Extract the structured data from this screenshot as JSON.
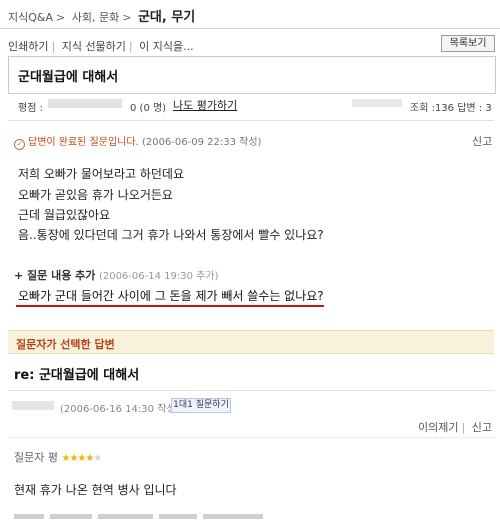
{
  "breadcrumb": {
    "root": "지식Q&A",
    "section": "사회, 문화",
    "current": "군대, 무기"
  },
  "toolbar": {
    "print": "인쇄하기",
    "gift": "지식 선물하기",
    "thisknow": "이 지식을...",
    "list_button": "목록보기"
  },
  "question": {
    "title": "군대월급에 대해서",
    "rating_label": "평점 :",
    "rating_value": "0 (0 명)",
    "rate_link": "나도 평가하기",
    "views": "조회 :136  답변 : 3",
    "done_status": "답변이 완료된 질문입니다.",
    "done_date": "(2006-06-09 22:33 작성)",
    "report": "신고",
    "lines": [
      "저희 오빠가 물어보라고 하던데요",
      "오빠가 곧있음 휴가 나오거든요",
      "근데 월급있잖아요",
      "음..통장에 있다던데 그거 휴가 나와서 통장에서 빨수 있나요?"
    ],
    "add_label": "+ 질문 내용 추가",
    "add_date": "(2006-06-14 19:30 추가)",
    "add_text": "오빠가 군대 들어간 사이에 그 돈을 제가 빼서 쓸수는 없나요?"
  },
  "selected": {
    "header": "질문자가 선택한 답변",
    "title": "re: 군대월급에 대해서",
    "date": "(2006-06-16 14:30 작성)",
    "one_on_one": "1대1 질문하기",
    "objection": "이의제기",
    "report": "신고",
    "questioner_label": "질문자 평",
    "stars_filled": "★★★★",
    "stars_empty": "★",
    "answer_first": "현재 휴가 나온 현역 병사 입니다"
  },
  "colors": {
    "accent_red": "#c01616",
    "status_orange": "#c8481a",
    "selected_bg": "#f8f2dc"
  }
}
